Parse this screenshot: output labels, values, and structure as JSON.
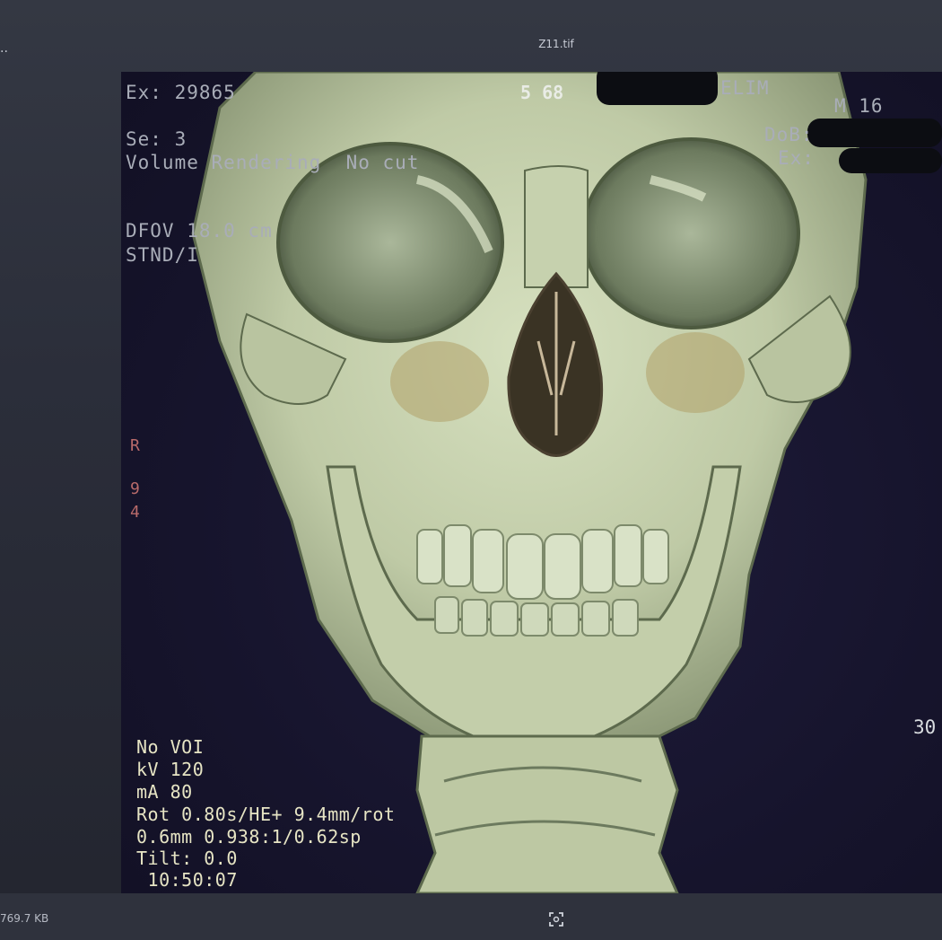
{
  "window": {
    "title": "Z11.tif",
    "ellipsis": ".."
  },
  "overlay": {
    "exam": "Ex: 29865",
    "series_num": "5 68",
    "site_partial": "ELIM",
    "age_sex": "M 16",
    "dob_label": "DoB:",
    "ex_label": "Ex:",
    "series": "Se: 3",
    "render_mode": "Volume Rendering  No cut",
    "dfov": "DFOV 18.0 cm",
    "recon": "STND/I",
    "orientation": "R",
    "side_num_1": "9",
    "side_num_2": "4",
    "right_value": "30",
    "voi": "No VOI",
    "kv": "kV 120",
    "ma": "mA 80",
    "rot": "Rot 0.80s/HE+ 9.4mm/rot",
    "slice": "0.6mm 0.938:1/0.62sp",
    "tilt": "Tilt: 0.0",
    "time": " 10:50:07"
  },
  "status": {
    "file_size": "769.7 KB"
  },
  "colors": {
    "bone": "#c8d4b0",
    "bone_shadow": "#6f7c5e",
    "background": "#16142c"
  }
}
